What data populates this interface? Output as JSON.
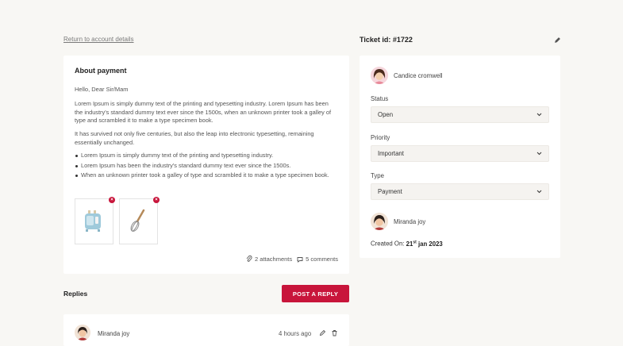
{
  "nav": {
    "back_label": "Return to account details"
  },
  "ticket": {
    "id_label": "Ticket id: #1722",
    "title": "About payment",
    "greeting": "Hello, Dear Sir/Mam",
    "paragraph1": "Lorem Ipsum is simply dummy text of the printing and typesetting industry. Lorem Ipsum has been the industry's standard dummy text ever since the 1500s, when an unknown printer took a galley of type and scrambled it to make a type specimen book.",
    "paragraph2": "It has survived not only five centuries, but also the leap into electronic typesetting, remaining essentially unchanged.",
    "bullets": [
      "Lorem Ipsum is simply dummy text of the printing and typesetting industry.",
      "Lorem Ipsum has been the industry's standard dummy text ever since the 1500s.",
      "When an unknown printer took a galley of type and scrambled it to make a type specimen book."
    ],
    "attachments_label": "2 attachments",
    "comments_label": "5 comments",
    "attachments": [
      {
        "icon": "toaster-icon"
      },
      {
        "icon": "whisk-icon"
      }
    ]
  },
  "replies": {
    "title": "Replies",
    "post_label": "POST A REPLY",
    "items": [
      {
        "author": "Miranda joy",
        "time": "4 hours ago"
      }
    ]
  },
  "sidebar": {
    "assignee": "Candice cromwell",
    "status_label": "Status",
    "status_value": "Open",
    "priority_label": "Priority",
    "priority_value": "Important",
    "type_label": "Type",
    "type_value": "Payment",
    "reporter": "Miranda joy",
    "created_prefix": "Created On:",
    "created_day": "21",
    "created_suffix": "st",
    "created_rest": " jan 2023"
  },
  "colors": {
    "accent": "#c8153b",
    "background": "#f8f7f4",
    "card": "#ffffff"
  }
}
